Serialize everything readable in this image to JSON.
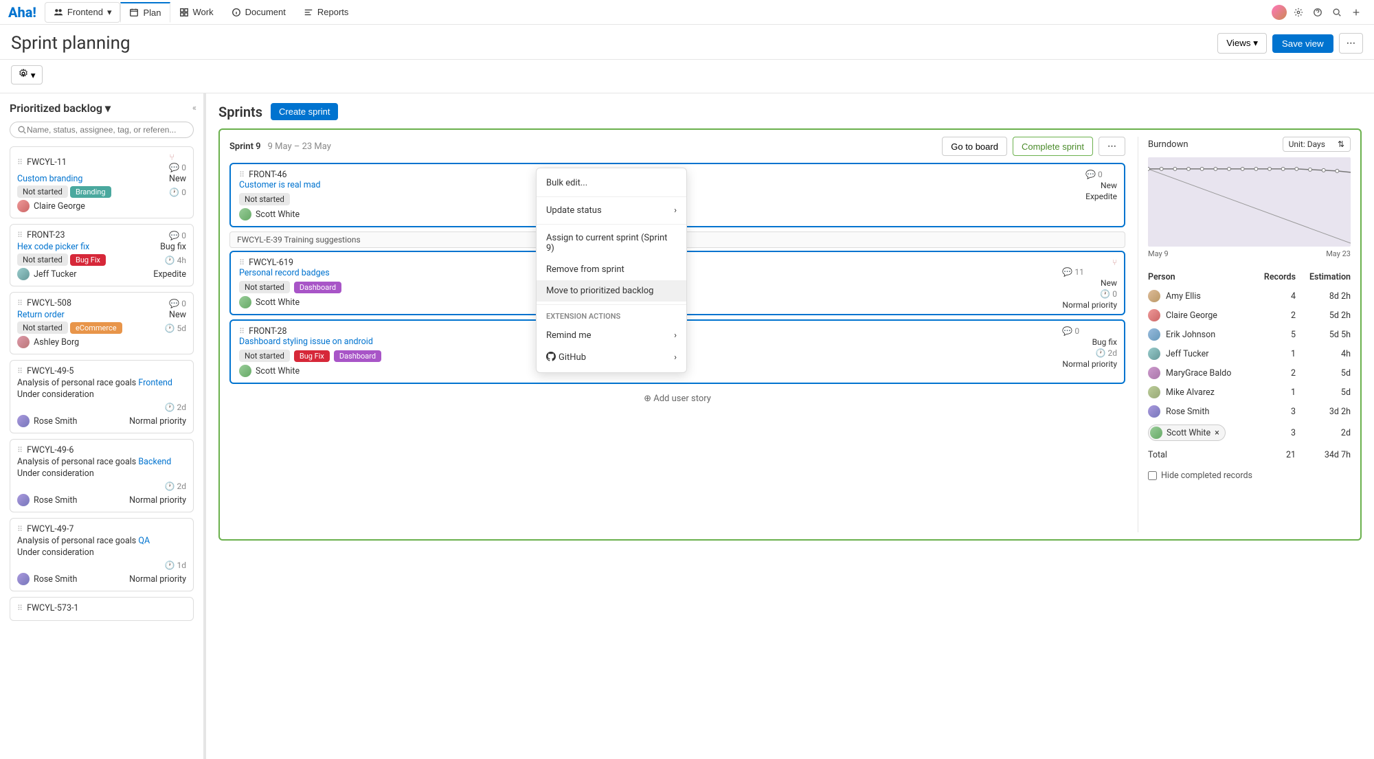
{
  "nav": {
    "logo": "Aha!",
    "workspace": "Frontend",
    "tabs": {
      "plan": "Plan",
      "work": "Work",
      "document": "Document",
      "reports": "Reports"
    }
  },
  "header": {
    "page_title": "Sprint planning",
    "views_btn": "Views",
    "save_view": "Save view"
  },
  "sidebar": {
    "title": "Prioritized backlog",
    "search_placeholder": "Name, status, assignee, tag, or referen...",
    "cards": [
      {
        "id": "FWCYL-11",
        "title": "Custom branding",
        "status": "Not started",
        "tag": "Branding",
        "tag_class": "tag-branding",
        "comments": 0,
        "state": "New",
        "time": "0",
        "assignee": "Claire George",
        "av": "av-cg",
        "tree": true
      },
      {
        "id": "FRONT-23",
        "title": "Hex code picker fix",
        "status": "Not started",
        "tag": "Bug Fix",
        "tag_class": "tag-bugfix",
        "comments": 0,
        "state": "Bug fix",
        "time": "4h",
        "assignee": "Jeff Tucker",
        "av": "av-jt",
        "priority": "Expedite"
      },
      {
        "id": "FWCYL-508",
        "title": "Return order",
        "status": "Not started",
        "tag": "eCommerce",
        "tag_class": "tag-ecom",
        "comments": 0,
        "state": "New",
        "time": "5d",
        "assignee": "Ashley Borg",
        "av": "av-ab"
      },
      {
        "id": "FWCYL-49-5",
        "title": "Analysis of personal race goals",
        "suffix": "Frontend",
        "sub": "Under consideration",
        "comments": null,
        "time": "2d",
        "assignee": "Rose Smith",
        "av": "av-rs",
        "priority": "Normal priority"
      },
      {
        "id": "FWCYL-49-6",
        "title": "Analysis of personal race goals",
        "suffix": "Backend",
        "sub": "Under consideration",
        "time": "2d",
        "assignee": "Rose Smith",
        "av": "av-rs",
        "priority": "Normal priority"
      },
      {
        "id": "FWCYL-49-7",
        "title": "Analysis of personal race goals",
        "suffix": "QA",
        "sub": "Under consideration",
        "time": "1d",
        "assignee": "Rose Smith",
        "av": "av-rs",
        "priority": "Normal priority"
      },
      {
        "id": "FWCYL-573-1"
      }
    ]
  },
  "sprints": {
    "title": "Sprints",
    "create_btn": "Create sprint",
    "sprint_name": "Sprint 9",
    "sprint_dates": "9 May – 23 May",
    "go_board": "Go to board",
    "complete": "Complete sprint",
    "placeholder": "FWCYL-E-39 Training suggestions",
    "add_story": "Add user story",
    "stories": [
      {
        "id": "FRONT-46",
        "title": "Customer is real mad",
        "status": "Not started",
        "comments": 0,
        "state": "New",
        "assignee": "Scott White",
        "priority": "Expedite"
      },
      {
        "id": "FWCYL-619",
        "title": "Personal record badges",
        "status": "Not started",
        "tags": [
          "Dashboard"
        ],
        "tag_classes": [
          "tag-dash"
        ],
        "comments": 11,
        "state": "New",
        "time": "0",
        "assignee": "Scott White",
        "priority": "Normal priority",
        "tree": true
      },
      {
        "id": "FRONT-28",
        "title": "Dashboard styling issue on android",
        "status": "Not started",
        "tags": [
          "Bug Fix",
          "Dashboard"
        ],
        "tag_classes": [
          "tag-bugfix",
          "tag-dash"
        ],
        "comments": 0,
        "state": "Bug fix",
        "time": "2d",
        "assignee": "Scott White",
        "priority": "Normal priority"
      }
    ]
  },
  "ctx": {
    "bulk_edit": "Bulk edit...",
    "update_status": "Update status",
    "assign": "Assign to current sprint (Sprint 9)",
    "remove": "Remove from sprint",
    "move": "Move to prioritized backlog",
    "ext_hdr": "EXTENSION ACTIONS",
    "remind": "Remind me",
    "github": "GitHub"
  },
  "burndown": {
    "title": "Burndown",
    "unit": "Unit: Days",
    "x_start": "May 9",
    "x_end": "May 23"
  },
  "people": {
    "hdr_person": "Person",
    "hdr_records": "Records",
    "hdr_est": "Estimation",
    "rows": [
      {
        "name": "Amy Ellis",
        "av": "av-ae",
        "rec": "4",
        "est": "8d 2h"
      },
      {
        "name": "Claire George",
        "av": "av-cg",
        "rec": "2",
        "est": "5d 2h"
      },
      {
        "name": "Erik Johnson",
        "av": "av-ej",
        "rec": "5",
        "est": "5d 5h"
      },
      {
        "name": "Jeff Tucker",
        "av": "av-jt",
        "rec": "1",
        "est": "4h"
      },
      {
        "name": "MaryGrace Baldo",
        "av": "av-mb",
        "rec": "2",
        "est": "5d"
      },
      {
        "name": "Mike Alvarez",
        "av": "av-ma",
        "rec": "1",
        "est": "5d"
      },
      {
        "name": "Rose Smith",
        "av": "av-rs",
        "rec": "3",
        "est": "3d 2h"
      },
      {
        "name": "Scott White",
        "av": "av-sw",
        "rec": "3",
        "est": "2d",
        "chip": true
      }
    ],
    "total_label": "Total",
    "total_rec": "21",
    "total_est": "34d 7h",
    "hide_label": "Hide completed records"
  },
  "chart_data": {
    "type": "line",
    "title": "Burndown",
    "xlabel": "",
    "ylabel": "",
    "x_start": "May 9",
    "x_end": "May 23",
    "series": [
      {
        "name": "Ideal",
        "values": [
          34,
          31,
          28,
          25,
          23,
          20,
          17,
          14,
          11,
          9,
          6,
          3,
          0
        ]
      },
      {
        "name": "Actual",
        "values": [
          34,
          34,
          34,
          34,
          34,
          34,
          34,
          34,
          34,
          34,
          34,
          34,
          34,
          34,
          34
        ]
      }
    ],
    "ylim": [
      0,
      35
    ]
  }
}
